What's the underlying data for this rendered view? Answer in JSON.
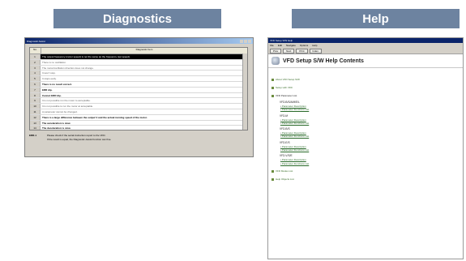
{
  "headers": {
    "diagnostics": "Diagnostics",
    "help": "Help"
  },
  "diagnostics": {
    "window_title": "Diagnostic Assist",
    "table_head": {
      "no": "No.",
      "item": "Diagnostic Item"
    },
    "rows": [
      {
        "no": "1",
        "text": "The output frequency (motor speed) is not the same as the frequency (set speed).",
        "style": "sel"
      },
      {
        "no": "2",
        "text": "There is no oscillation.",
        "style": ""
      },
      {
        "no": "3",
        "text": "The motor/oscillation direction does not change.",
        "style": ""
      },
      {
        "no": "4",
        "text": "It won't stop.",
        "style": ""
      },
      {
        "no": "5",
        "text": "It stops early.",
        "style": ""
      },
      {
        "no": "6",
        "text": "There is no result correct.",
        "style": "bold"
      },
      {
        "no": "7",
        "text": "ERR dip.",
        "style": "bold"
      },
      {
        "no": "8",
        "text": "Cannot ERR dip.",
        "style": "bold"
      },
      {
        "no": "9",
        "text": "It is not possible run the motor to acceptable.",
        "style": ""
      },
      {
        "no": "10",
        "text": "It is not possible to run the motor at acceptable.",
        "style": ""
      },
      {
        "no": "11",
        "text": "A parameter cannot be changed.",
        "style": ""
      },
      {
        "no": "12",
        "text": "There is a large difference between the output V and the actual running speed of the motor.",
        "style": "bold"
      },
      {
        "no": "13",
        "text": "The acceleration is slow.",
        "style": "bold"
      },
      {
        "no": "14",
        "text": "The deceleration is slow.",
        "style": "bold"
      }
    ],
    "footer_label": "ERR-1",
    "footer_lines": [
      "Please check if the serial instruction report to the VFD.",
      "If the result is equal, the Diagnostic-Assist function can fine."
    ]
  },
  "help": {
    "window_title": "VFD Setup S/W Help",
    "menu": [
      "File",
      "Edit",
      "Navigate",
      "Options",
      "Help"
    ],
    "toolbar": [
      "Prev",
      "Next",
      "Print",
      "Index"
    ],
    "page_title": "VFD Setup S/W Help Contents",
    "toc_top": [
      "About VFD Setup S/W",
      "Setup with VFD"
    ],
    "param_list_label": "VFD Parameter List",
    "groups": [
      {
        "name": "VFD-B/S/A/M/E/L",
        "links": [
          "Parameter Description",
          "Parameter Functions List"
        ]
      },
      {
        "name": "VFD-M",
        "links": [
          "Parameter Description",
          "Parameter Functions List"
        ]
      },
      {
        "name": "VFD-B/S",
        "links": [
          "Parameter Description",
          "Parameter Functions List"
        ]
      },
      {
        "name": "VFD-E/S",
        "links": [
          "Parameter Description",
          "Parameter Functions List"
        ]
      },
      {
        "name": "VFD-V/S/E",
        "links": [
          "Parameter Description",
          "Parameter Functions List"
        ]
      }
    ],
    "toc_bottom": [
      "VFD Modes List",
      "Help Objects List"
    ]
  }
}
